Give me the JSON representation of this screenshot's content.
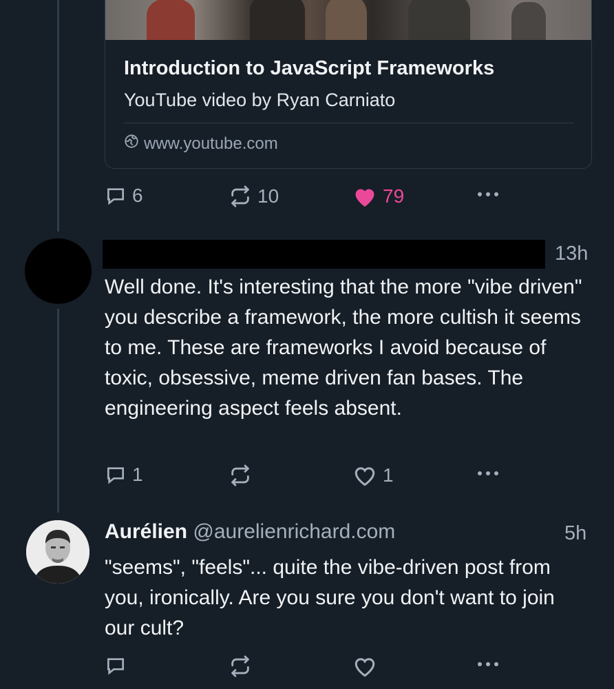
{
  "link_card": {
    "title": "Introduction to JavaScript Frameworks",
    "description": "YouTube video by Ryan Carniato",
    "domain": "www.youtube.com"
  },
  "post1": {
    "actions": {
      "replies": "6",
      "reposts": "10",
      "likes": "79"
    },
    "like_color": "#ec4899"
  },
  "post2": {
    "time": "13h",
    "body": "Well done. It's interesting that the more \"vibe driven\" you describe a framework, the more cultish it seems to me. These are frameworks I avoid because of toxic, obsessive, meme driven fan bases. The engineering aspect feels absent.",
    "actions": {
      "replies": "1",
      "likes": "1"
    }
  },
  "post3": {
    "author_name": "Aurélien",
    "author_handle": "@aurelienrichard.com",
    "time": "5h",
    "body": "\"seems\", \"feels\"... quite the vibe-driven post from you, ironically. Are you sure you don't want to join our cult?"
  },
  "icons": [
    "reply-icon",
    "repost-icon",
    "like-icon",
    "more-icon",
    "globe-icon"
  ],
  "colors": {
    "background": "#161e27",
    "thread_line": "#2c3e50",
    "muted_text": "#a4b0bd",
    "like_active": "#ec4899"
  }
}
